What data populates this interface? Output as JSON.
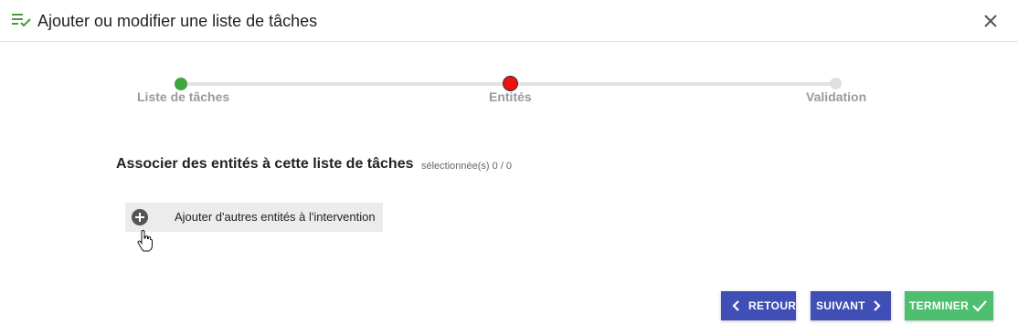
{
  "dialog": {
    "title": "Ajouter ou modifier une liste de tâches",
    "icon": "playlist-check-icon",
    "close_icon": "close-icon"
  },
  "stepper": {
    "steps": [
      {
        "label": "Liste de tâches",
        "state": "done",
        "color": "#3ea53e"
      },
      {
        "label": "Entités",
        "state": "current",
        "color": "#ee1111"
      },
      {
        "label": "Validation",
        "state": "todo",
        "color": "#e0e0e0"
      }
    ]
  },
  "section": {
    "title": "Associer des entités à cette liste de tâches",
    "count": "sélectionnée(s) 0 / 0"
  },
  "add_entity": {
    "label": "Ajouter d'autres entités à l'intervention",
    "icon": "plus-circle-icon"
  },
  "buttons": {
    "back_label": "RETOUR",
    "next_label": "SUIVANT",
    "finish_label": "TERMINER"
  },
  "colors": {
    "primary": "#3f4fb5",
    "success": "#4dbf6e",
    "brand_icon": "#4a9a3a"
  }
}
